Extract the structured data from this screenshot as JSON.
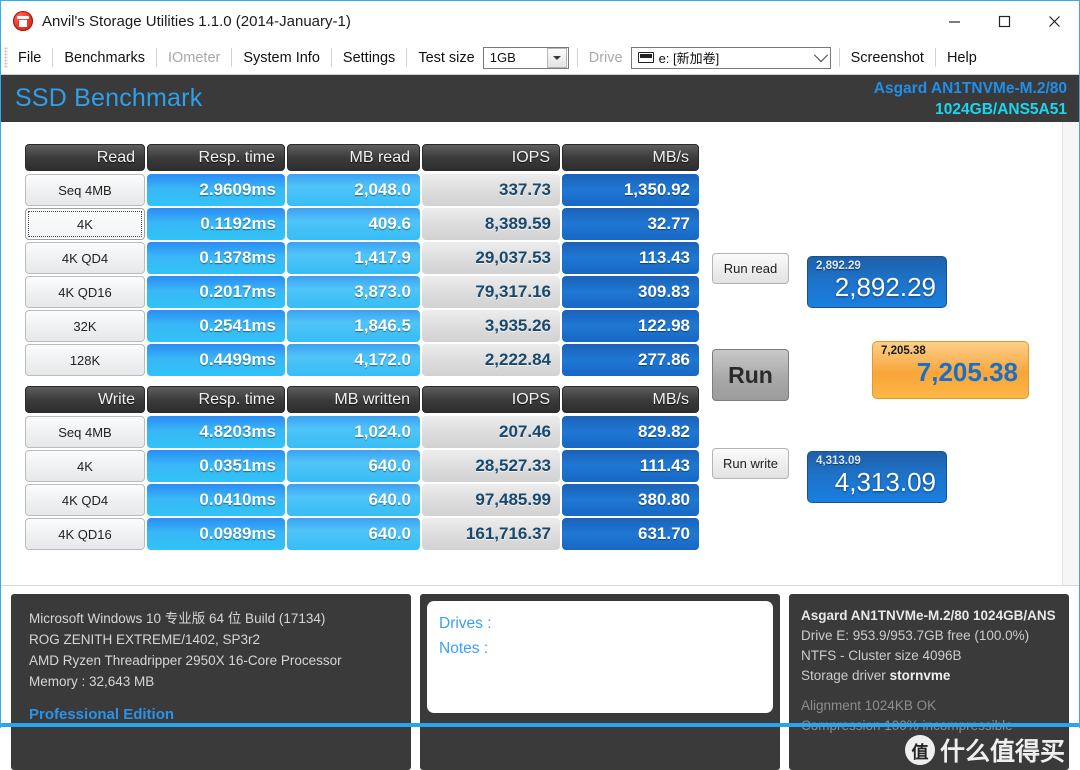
{
  "window": {
    "title": "Anvil's Storage Utilities 1.1.0 (2014-January-1)",
    "app_icon": "anvil-icon",
    "minimize": "–",
    "maximize": "☐",
    "close": "✕"
  },
  "menubar": {
    "items": [
      {
        "label": "File",
        "enabled": true
      },
      {
        "label": "Benchmarks",
        "enabled": true
      },
      {
        "label": "IOmeter",
        "enabled": false
      },
      {
        "label": "System Info",
        "enabled": true
      },
      {
        "label": "Settings",
        "enabled": true
      }
    ],
    "test_size_label": "Test size",
    "test_size_value": "1GB",
    "drive_label": "Drive",
    "drive_value": "e: [新加卷]",
    "screenshot_label": "Screenshot",
    "help_label": "Help"
  },
  "header": {
    "title": "SSD Benchmark",
    "drive_line1": "Asgard AN1TNVMe-M.2/80",
    "drive_line2": "1024GB/ANS5A51",
    "title_color": "#2f9fe8",
    "line1_color": "#1f8fe8",
    "line2_color": "#19d7f0"
  },
  "read_table": {
    "headers": [
      "Read",
      "Resp. time",
      "MB read",
      "IOPS",
      "MB/s"
    ],
    "rows": [
      {
        "label": "Seq 4MB",
        "resp": "2.9609ms",
        "mb": "2,048.0",
        "iops": "337.73",
        "mbs": "1,350.92",
        "focused": false
      },
      {
        "label": "4K",
        "resp": "0.1192ms",
        "mb": "409.6",
        "iops": "8,389.59",
        "mbs": "32.77",
        "focused": true
      },
      {
        "label": "4K QD4",
        "resp": "0.1378ms",
        "mb": "1,417.9",
        "iops": "29,037.53",
        "mbs": "113.43",
        "focused": false
      },
      {
        "label": "4K QD16",
        "resp": "0.2017ms",
        "mb": "3,873.0",
        "iops": "79,317.16",
        "mbs": "309.83",
        "focused": false
      },
      {
        "label": "32K",
        "resp": "0.2541ms",
        "mb": "1,846.5",
        "iops": "3,935.26",
        "mbs": "122.98",
        "focused": false
      },
      {
        "label": "128K",
        "resp": "0.4499ms",
        "mb": "4,172.0",
        "iops": "2,222.84",
        "mbs": "277.86",
        "focused": false
      }
    ]
  },
  "write_table": {
    "headers": [
      "Write",
      "Resp. time",
      "MB written",
      "IOPS",
      "MB/s"
    ],
    "rows": [
      {
        "label": "Seq 4MB",
        "resp": "4.8203ms",
        "mb": "1,024.0",
        "iops": "207.46",
        "mbs": "829.82",
        "focused": false
      },
      {
        "label": "4K",
        "resp": "0.0351ms",
        "mb": "640.0",
        "iops": "28,527.33",
        "mbs": "111.43",
        "focused": false
      },
      {
        "label": "4K QD4",
        "resp": "0.0410ms",
        "mb": "640.0",
        "iops": "97,485.99",
        "mbs": "380.80",
        "focused": false
      },
      {
        "label": "4K QD16",
        "resp": "0.0989ms",
        "mb": "640.0",
        "iops": "161,716.37",
        "mbs": "631.70",
        "focused": false
      }
    ]
  },
  "actions": {
    "run_read": "Run read",
    "run": "Run",
    "run_write": "Run write"
  },
  "scores": {
    "read": {
      "small": "2,892.29",
      "big": "2,892.29"
    },
    "total": {
      "small": "7,205.38",
      "big": "7,205.38"
    },
    "write": {
      "small": "4,313.09",
      "big": "4,313.09"
    }
  },
  "system_info": {
    "lines": [
      "Microsoft Windows 10 专业版 64 位 Build (17134)",
      "ROG ZENITH EXTREME/1402, SP3r2",
      "AMD Ryzen Threadripper 2950X 16-Core Processor",
      "Memory : 32,643 MB"
    ],
    "edition": "Professional Edition"
  },
  "notes": {
    "drives_label": "Drives :",
    "notes_label": "Notes :"
  },
  "drive_info": {
    "title": "Asgard AN1TNVMe-M.2/80 1024GB/ANS",
    "line_free": "Drive E: 953.9/953.7GB free (100.0%)",
    "line_fs": "NTFS - Cluster size 4096B",
    "line_driver_label": "Storage driver",
    "line_driver_value": "stornvme",
    "line_alignment": "Alignment 1024KB OK",
    "line_compression": "Compression 100% incompressible"
  },
  "watermark": {
    "badge": "值",
    "text": "什么值得买"
  }
}
